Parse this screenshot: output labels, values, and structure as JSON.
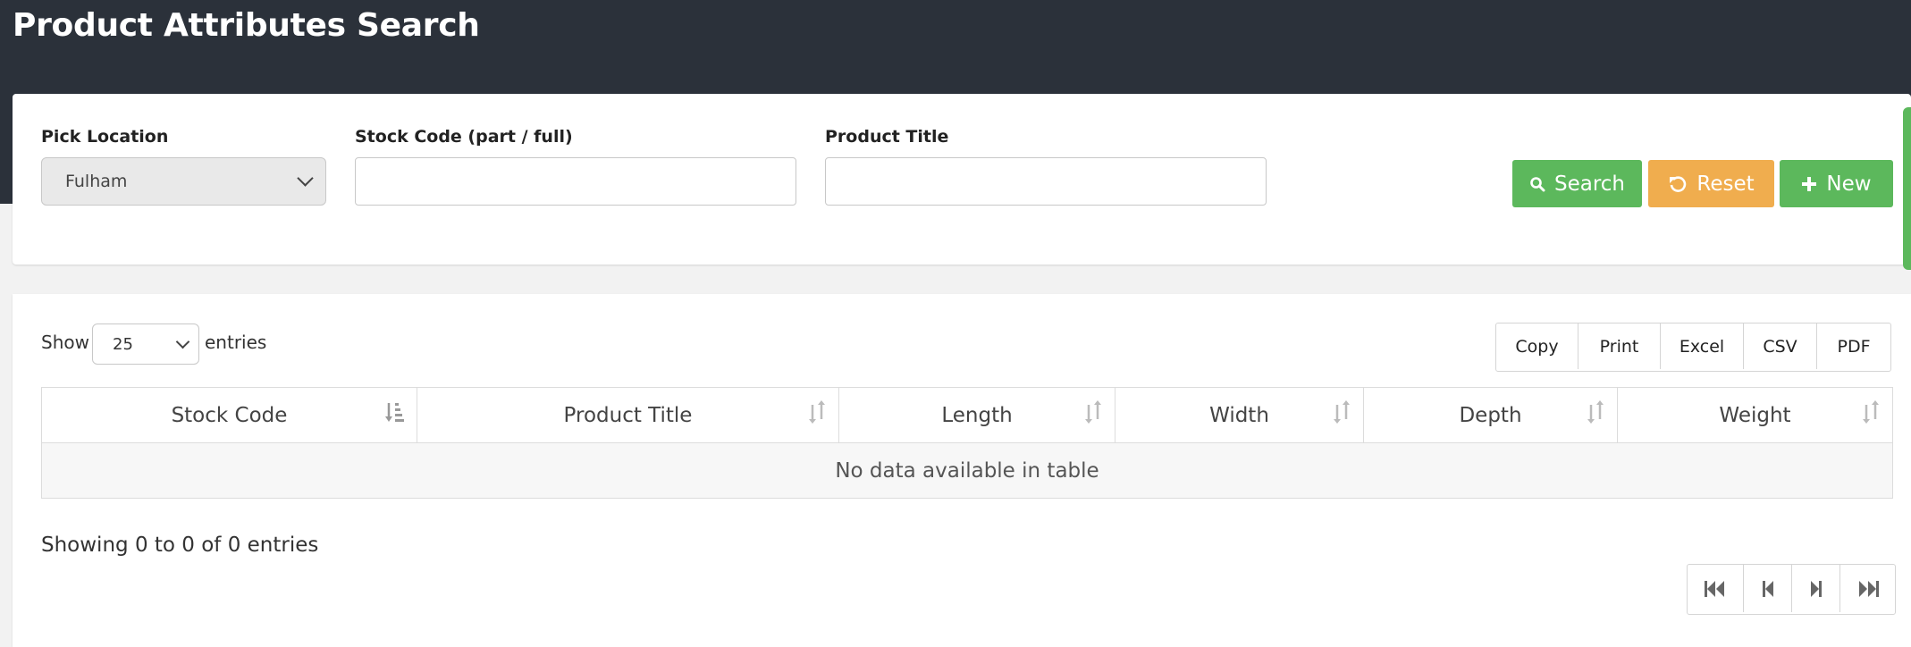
{
  "page": {
    "title": "Product Attributes Search"
  },
  "filters": {
    "pick_location": {
      "label": "Pick Location",
      "value": "Fulham"
    },
    "stock_code": {
      "label": "Stock Code (part / full)",
      "value": ""
    },
    "product_title": {
      "label": "Product Title",
      "value": ""
    }
  },
  "actions": {
    "search": "Search",
    "reset": "Reset",
    "new": "New"
  },
  "table_controls": {
    "show": "Show",
    "page_size": "25",
    "entries": "entries"
  },
  "export_buttons": [
    "Copy",
    "Print",
    "Excel",
    "CSV",
    "PDF"
  ],
  "table": {
    "columns": [
      "Stock Code",
      "Product Title",
      "Length",
      "Width",
      "Depth",
      "Weight"
    ],
    "empty_message": "No data available in table"
  },
  "info": "Showing 0 to 0 of 0 entries",
  "pagination": {
    "icons": [
      "first-page-icon",
      "previous-page-icon",
      "next-page-icon",
      "last-page-icon"
    ]
  },
  "colors": {
    "header_bg": "#2b313a",
    "primary_green": "#5cb85c",
    "warning_orange": "#f0ad4e"
  }
}
